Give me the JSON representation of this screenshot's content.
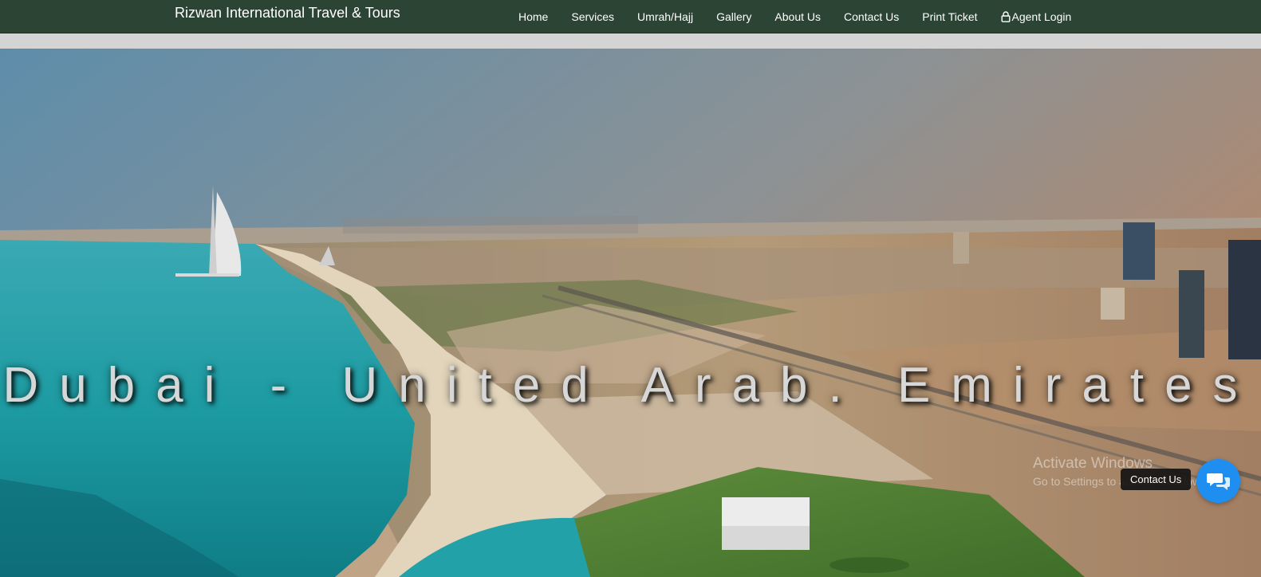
{
  "navbar": {
    "brand": "Rizwan International Travel & Tours",
    "links": [
      {
        "label": "Home"
      },
      {
        "label": "Services"
      },
      {
        "label": "Umrah/Hajj"
      },
      {
        "label": "Gallery"
      },
      {
        "label": "About Us"
      },
      {
        "label": "Contact Us"
      },
      {
        "label": "Print Ticket"
      },
      {
        "label": "Agent Login",
        "icon": "lock-icon"
      }
    ]
  },
  "hero": {
    "title": "Dubai - United Arab. Emirates",
    "image": "aerial-dubai-coastline"
  },
  "watermark": {
    "line1": "Activate Windows",
    "line2": "Go to Settings to activate Windows."
  },
  "chat_widget": {
    "label": "Contact Us",
    "icon": "chat-bubbles-icon",
    "color": "#1f8ef1"
  },
  "colors": {
    "navbar": "#2c4434",
    "band": "#d4d4d4"
  }
}
